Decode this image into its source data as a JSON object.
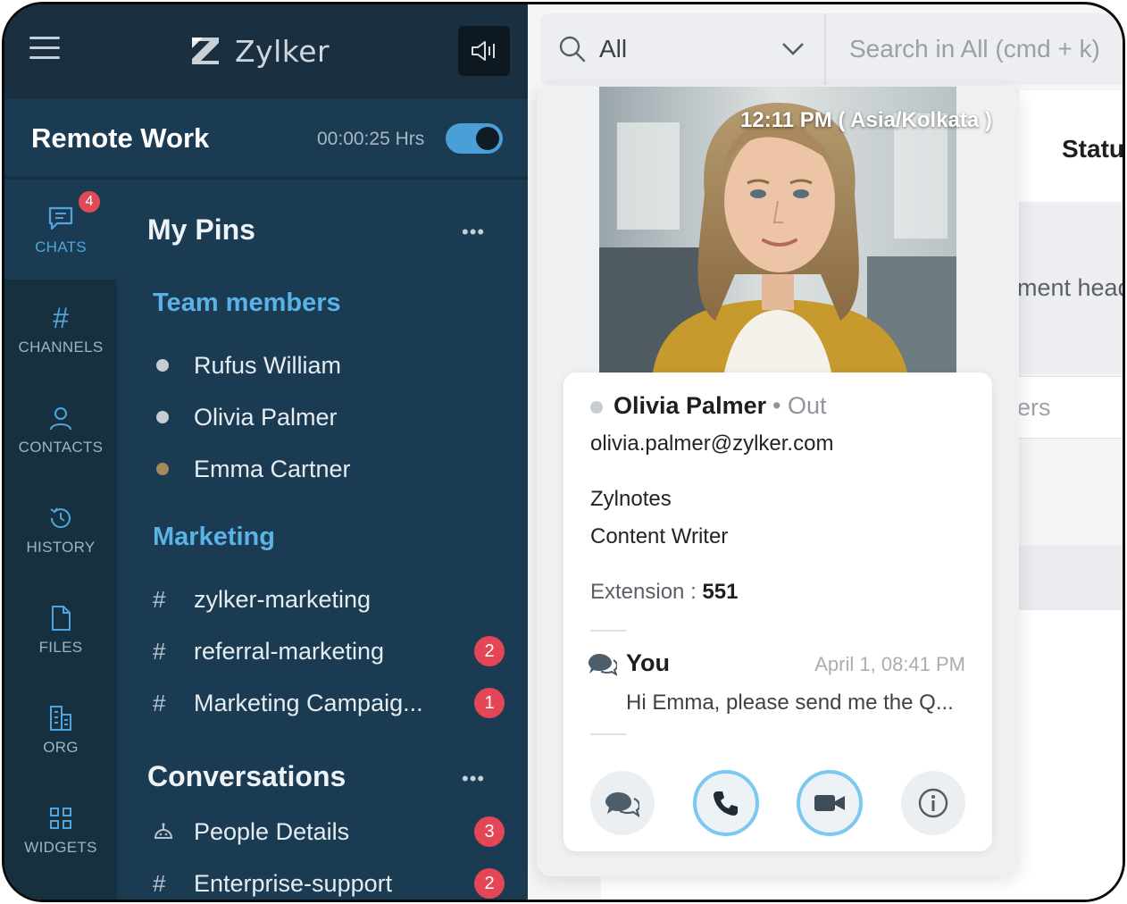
{
  "app": {
    "brand": "Zylker",
    "workspace_title": "Remote Work",
    "timer": "00:00:25 Hrs",
    "timer_enabled": true
  },
  "nav": [
    {
      "label": "CHATS",
      "icon": "chat-icon",
      "badge": "4",
      "active": true
    },
    {
      "label": "CHANNELS",
      "icon": "hash-icon"
    },
    {
      "label": "CONTACTS",
      "icon": "person-icon"
    },
    {
      "label": "HISTORY",
      "icon": "history-icon"
    },
    {
      "label": "FILES",
      "icon": "file-icon"
    },
    {
      "label": "ORG",
      "icon": "building-icon"
    },
    {
      "label": "WIDGETS",
      "icon": "grid-icon"
    }
  ],
  "pins": {
    "title": "My Pins",
    "more": "•••",
    "team_group": "Team members",
    "team_members": [
      {
        "name": "Rufus William",
        "status_color": "#c6cdd3"
      },
      {
        "name": "Olivia Palmer",
        "status_color": "#c6cdd3"
      },
      {
        "name": "Emma  Cartner",
        "status_color": "#a58a5a"
      }
    ],
    "marketing_group": "Marketing",
    "marketing_channels": [
      {
        "prefix": "#",
        "name": "zylker-marketing",
        "badge": ""
      },
      {
        "prefix": "#",
        "name": "referral-marketing",
        "badge": "2"
      },
      {
        "prefix": "#",
        "name": "Marketing Campaig...",
        "badge": "1"
      }
    ]
  },
  "conversations": {
    "title": "Conversations",
    "more": "•••",
    "items": [
      {
        "icon": "bot-icon",
        "name": "People Details",
        "badge": "3"
      },
      {
        "prefix": "#",
        "name": "Enterprise-support",
        "badge": "2"
      }
    ]
  },
  "search": {
    "scope": "All",
    "placeholder": "Search in All (cmd + k)"
  },
  "background": {
    "status_header": "Status",
    "head_fragment": "ment head",
    "ers_fragment": "ers"
  },
  "contact_card": {
    "time": "12:11 PM ( Asia/Kolkata )",
    "name": "Olivia Palmer",
    "status": "• Out",
    "email": "olivia.palmer@zylker.com",
    "company": "Zylnotes",
    "role": "Content Writer",
    "extension_label": "Extension : ",
    "extension": "551",
    "last_message": {
      "sender": "You",
      "date": "April 1, 08:41 PM",
      "preview": "Hi Emma, please send me the Q..."
    },
    "actions": [
      "chat-icon",
      "phone-icon",
      "video-icon",
      "info-icon"
    ]
  }
}
